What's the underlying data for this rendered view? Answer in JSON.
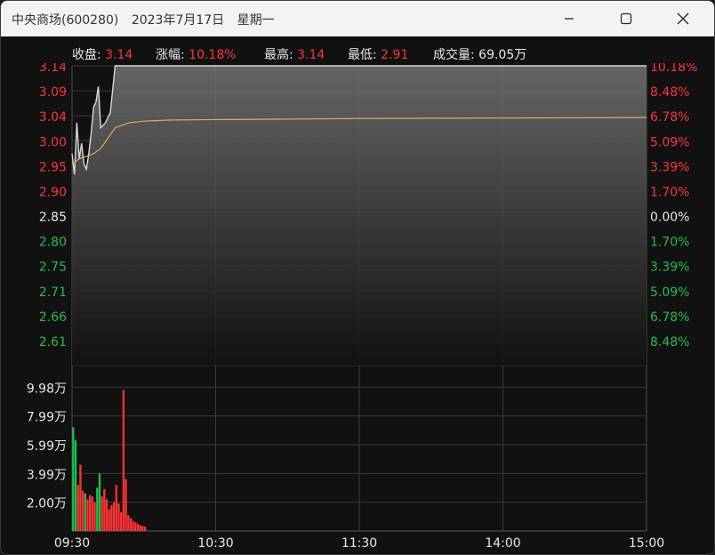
{
  "window": {
    "stock_name": "中央商场(600280)",
    "date": "2023年7月17日",
    "weekday": "星期一"
  },
  "info": {
    "close_label": "收盘:",
    "close_value": "3.14",
    "change_label": "涨幅:",
    "change_value": "10.18%",
    "high_label": "最高:",
    "high_value": "3.14",
    "low_label": "最低:",
    "low_value": "2.91",
    "volume_label": "成交量:",
    "volume_value": "69.05万"
  },
  "colors": {
    "up": "#ff3333",
    "down": "#18c24a",
    "neutral": "#e8e8e8",
    "price_line": "#d9d9d9",
    "avg_line": "#d8b060",
    "grid": "#3a3a3a"
  },
  "chart_data": [
    {
      "type": "line",
      "title": "",
      "x_ticks": [
        "09:30",
        "10:30",
        "11:30",
        "14:00",
        "15:00"
      ],
      "y_ticks_price": [
        "3.14",
        "3.09",
        "3.04",
        "3.00",
        "2.95",
        "2.90",
        "2.85",
        "2.80",
        "2.75",
        "2.71",
        "2.66",
        "2.61"
      ],
      "y_ticks_pct": [
        "10.18%",
        "8.48%",
        "6.78%",
        "5.09%",
        "3.39%",
        "1.70%",
        "0.00%",
        "1.70%",
        "3.39%",
        "5.09%",
        "6.78%",
        "8.48%"
      ],
      "ylim": [
        2.56,
        3.14
      ],
      "reference_price": 2.85,
      "series": [
        {
          "values_minute_index": [
            0,
            1,
            2,
            3,
            4,
            5,
            6,
            7,
            8,
            9,
            10,
            11,
            12,
            14,
            16,
            18,
            20,
            22,
            24,
            26,
            240
          ],
          "values": [
            2.97,
            2.93,
            3.03,
            2.96,
            2.99,
            2.95,
            2.94,
            2.97,
            3.01,
            3.06,
            3.07,
            3.1,
            3.02,
            3.03,
            3.05,
            3.14,
            3.14,
            3.14,
            3.14,
            3.14,
            3.14
          ]
        },
        {
          "values_minute_index": [
            0,
            3,
            6,
            9,
            12,
            15,
            18,
            21,
            24,
            30,
            40,
            60,
            90,
            120,
            180,
            240
          ],
          "values": [
            2.95,
            2.96,
            2.965,
            2.97,
            2.98,
            3.0,
            3.02,
            3.025,
            3.03,
            3.033,
            3.035,
            3.036,
            3.037,
            3.038,
            3.039,
            3.04
          ]
        }
      ]
    },
    {
      "type": "bar",
      "title": "",
      "y_ticks": [
        "9.98万",
        "7.99万",
        "5.99万",
        "3.99万",
        "2.00万"
      ],
      "ylim": [
        0,
        10.5
      ],
      "unit": "万",
      "minute_index": [
        0,
        1,
        2,
        3,
        4,
        5,
        6,
        7,
        8,
        9,
        10,
        11,
        12,
        13,
        14,
        15,
        16,
        17,
        18,
        19,
        20,
        21,
        22,
        23,
        24,
        25,
        26,
        27,
        28,
        29,
        30
      ],
      "values": [
        7.2,
        6.3,
        3.2,
        4.6,
        2.8,
        2.6,
        2.2,
        2.5,
        2.4,
        2.0,
        3.0,
        4.0,
        2.4,
        2.9,
        2.2,
        1.5,
        1.8,
        2.0,
        3.2,
        1.9,
        1.3,
        9.8,
        3.6,
        1.1,
        0.9,
        0.7,
        0.6,
        0.5,
        0.4,
        0.35,
        0.3
      ],
      "up": [
        false,
        false,
        true,
        true,
        true,
        false,
        true,
        true,
        true,
        true,
        false,
        false,
        true,
        true,
        true,
        true,
        true,
        true,
        true,
        true,
        true,
        true,
        true,
        true,
        true,
        true,
        true,
        true,
        true,
        true,
        true
      ]
    }
  ]
}
